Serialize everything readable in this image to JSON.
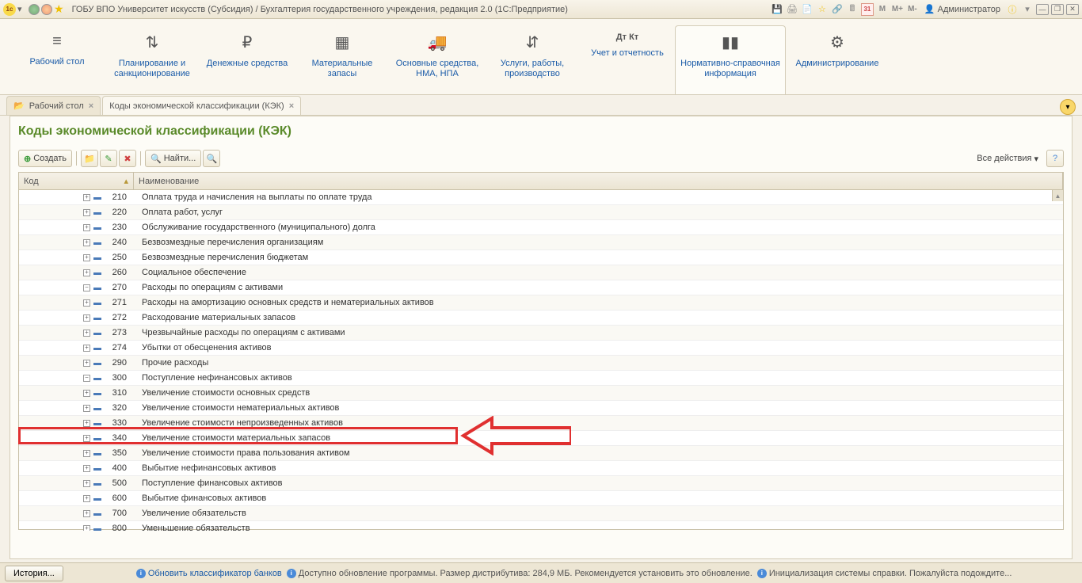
{
  "titlebar": {
    "title": "ГОБУ ВПО Университет искусств (Субсидия) / Бухгалтерия государственного учреждения, редакция 2.0  (1С:Предприятие)",
    "cal_text": "31",
    "m": "M",
    "mp": "M+",
    "mm": "M-",
    "user": "Администратор"
  },
  "sections": [
    {
      "icon": "≡",
      "label": "Рабочий стол"
    },
    {
      "icon": "⇅",
      "label": "Планирование и санкционирование"
    },
    {
      "icon": "₽",
      "label": "Денежные средства"
    },
    {
      "icon": "▦",
      "label": "Материальные запасы"
    },
    {
      "icon": "🚚",
      "label": "Основные средства, НМА, НПА"
    },
    {
      "icon": "⇵",
      "label": "Услуги, работы, производство"
    },
    {
      "icon": "Дт Кт",
      "label": "Учет и отчетность"
    },
    {
      "icon": "▮▮",
      "label": "Нормативно-справочная информация"
    },
    {
      "icon": "⚙",
      "label": "Администрирование"
    }
  ],
  "tabs": [
    {
      "label": "Рабочий стол"
    },
    {
      "label": "Коды экономической классификации (КЭК)"
    }
  ],
  "page_title": "Коды экономической классификации (КЭК)",
  "toolbar": {
    "create": "Создать",
    "find": "Найти...",
    "all_actions": "Все действия"
  },
  "table": {
    "col_code": "Код",
    "col_name": "Наименование",
    "rows": [
      {
        "indent": 1,
        "exp": "+",
        "code": "210",
        "name": "Оплата труда и начисления на выплаты по оплате труда"
      },
      {
        "indent": 1,
        "exp": "+",
        "code": "220",
        "name": "Оплата работ, услуг"
      },
      {
        "indent": 1,
        "exp": "+",
        "code": "230",
        "name": "Обслуживание государственного (муниципального) долга"
      },
      {
        "indent": 1,
        "exp": "+",
        "code": "240",
        "name": "Безвозмездные перечисления организациям"
      },
      {
        "indent": 1,
        "exp": "+",
        "code": "250",
        "name": "Безвозмездные перечисления бюджетам"
      },
      {
        "indent": 1,
        "exp": "+",
        "code": "260",
        "name": "Социальное обеспечение"
      },
      {
        "indent": 1,
        "exp": "-",
        "code": "270",
        "name": "Расходы по операциям с активами"
      },
      {
        "indent": 2,
        "exp": "+",
        "code": "271",
        "name": "Расходы на амортизацию основных средств и нематериальных активов"
      },
      {
        "indent": 2,
        "exp": "+",
        "code": "272",
        "name": "Расходование материальных запасов"
      },
      {
        "indent": 2,
        "exp": "+",
        "code": "273",
        "name": "Чрезвычайные расходы по операциям с активами"
      },
      {
        "indent": 2,
        "exp": "+",
        "code": "274",
        "name": "Убытки от обесценения активов"
      },
      {
        "indent": 1,
        "exp": "+",
        "code": "290",
        "name": "Прочие расходы"
      },
      {
        "indent": 0,
        "exp": "-",
        "code": "300",
        "name": "Поступление нефинансовых активов"
      },
      {
        "indent": 1,
        "exp": "+",
        "code": "310",
        "name": "Увеличение стоимости основных средств"
      },
      {
        "indent": 1,
        "exp": "+",
        "code": "320",
        "name": "Увеличение стоимости нематериальных активов"
      },
      {
        "indent": 1,
        "exp": "+",
        "code": "330",
        "name": "Увеличение стоимости непроизведенных активов"
      },
      {
        "indent": 1,
        "exp": "+",
        "code": "340",
        "name": "Увеличение стоимости материальных запасов"
      },
      {
        "indent": 1,
        "exp": "+",
        "code": "350",
        "name": "Увеличение стоимости права пользования активом"
      },
      {
        "indent": 0,
        "exp": "+",
        "code": "400",
        "name": "Выбытие нефинансовых активов"
      },
      {
        "indent": 0,
        "exp": "+",
        "code": "500",
        "name": "Поступление финансовых активов"
      },
      {
        "indent": 0,
        "exp": "+",
        "code": "600",
        "name": "Выбытие финансовых активов"
      },
      {
        "indent": 0,
        "exp": "+",
        "code": "700",
        "name": "Увеличение обязательств"
      },
      {
        "indent": 0,
        "exp": "+",
        "code": "800",
        "name": "Уменьшение обязательств"
      }
    ]
  },
  "statusbar": {
    "history": "История...",
    "link1": "Обновить классификатор банков",
    "text1": "Доступно обновление программы. Размер дистрибутива: 284,9 МБ. Рекомендуется установить это обновление.",
    "link2": "Инициализация системы справки. Пожалуйста подождите..."
  }
}
